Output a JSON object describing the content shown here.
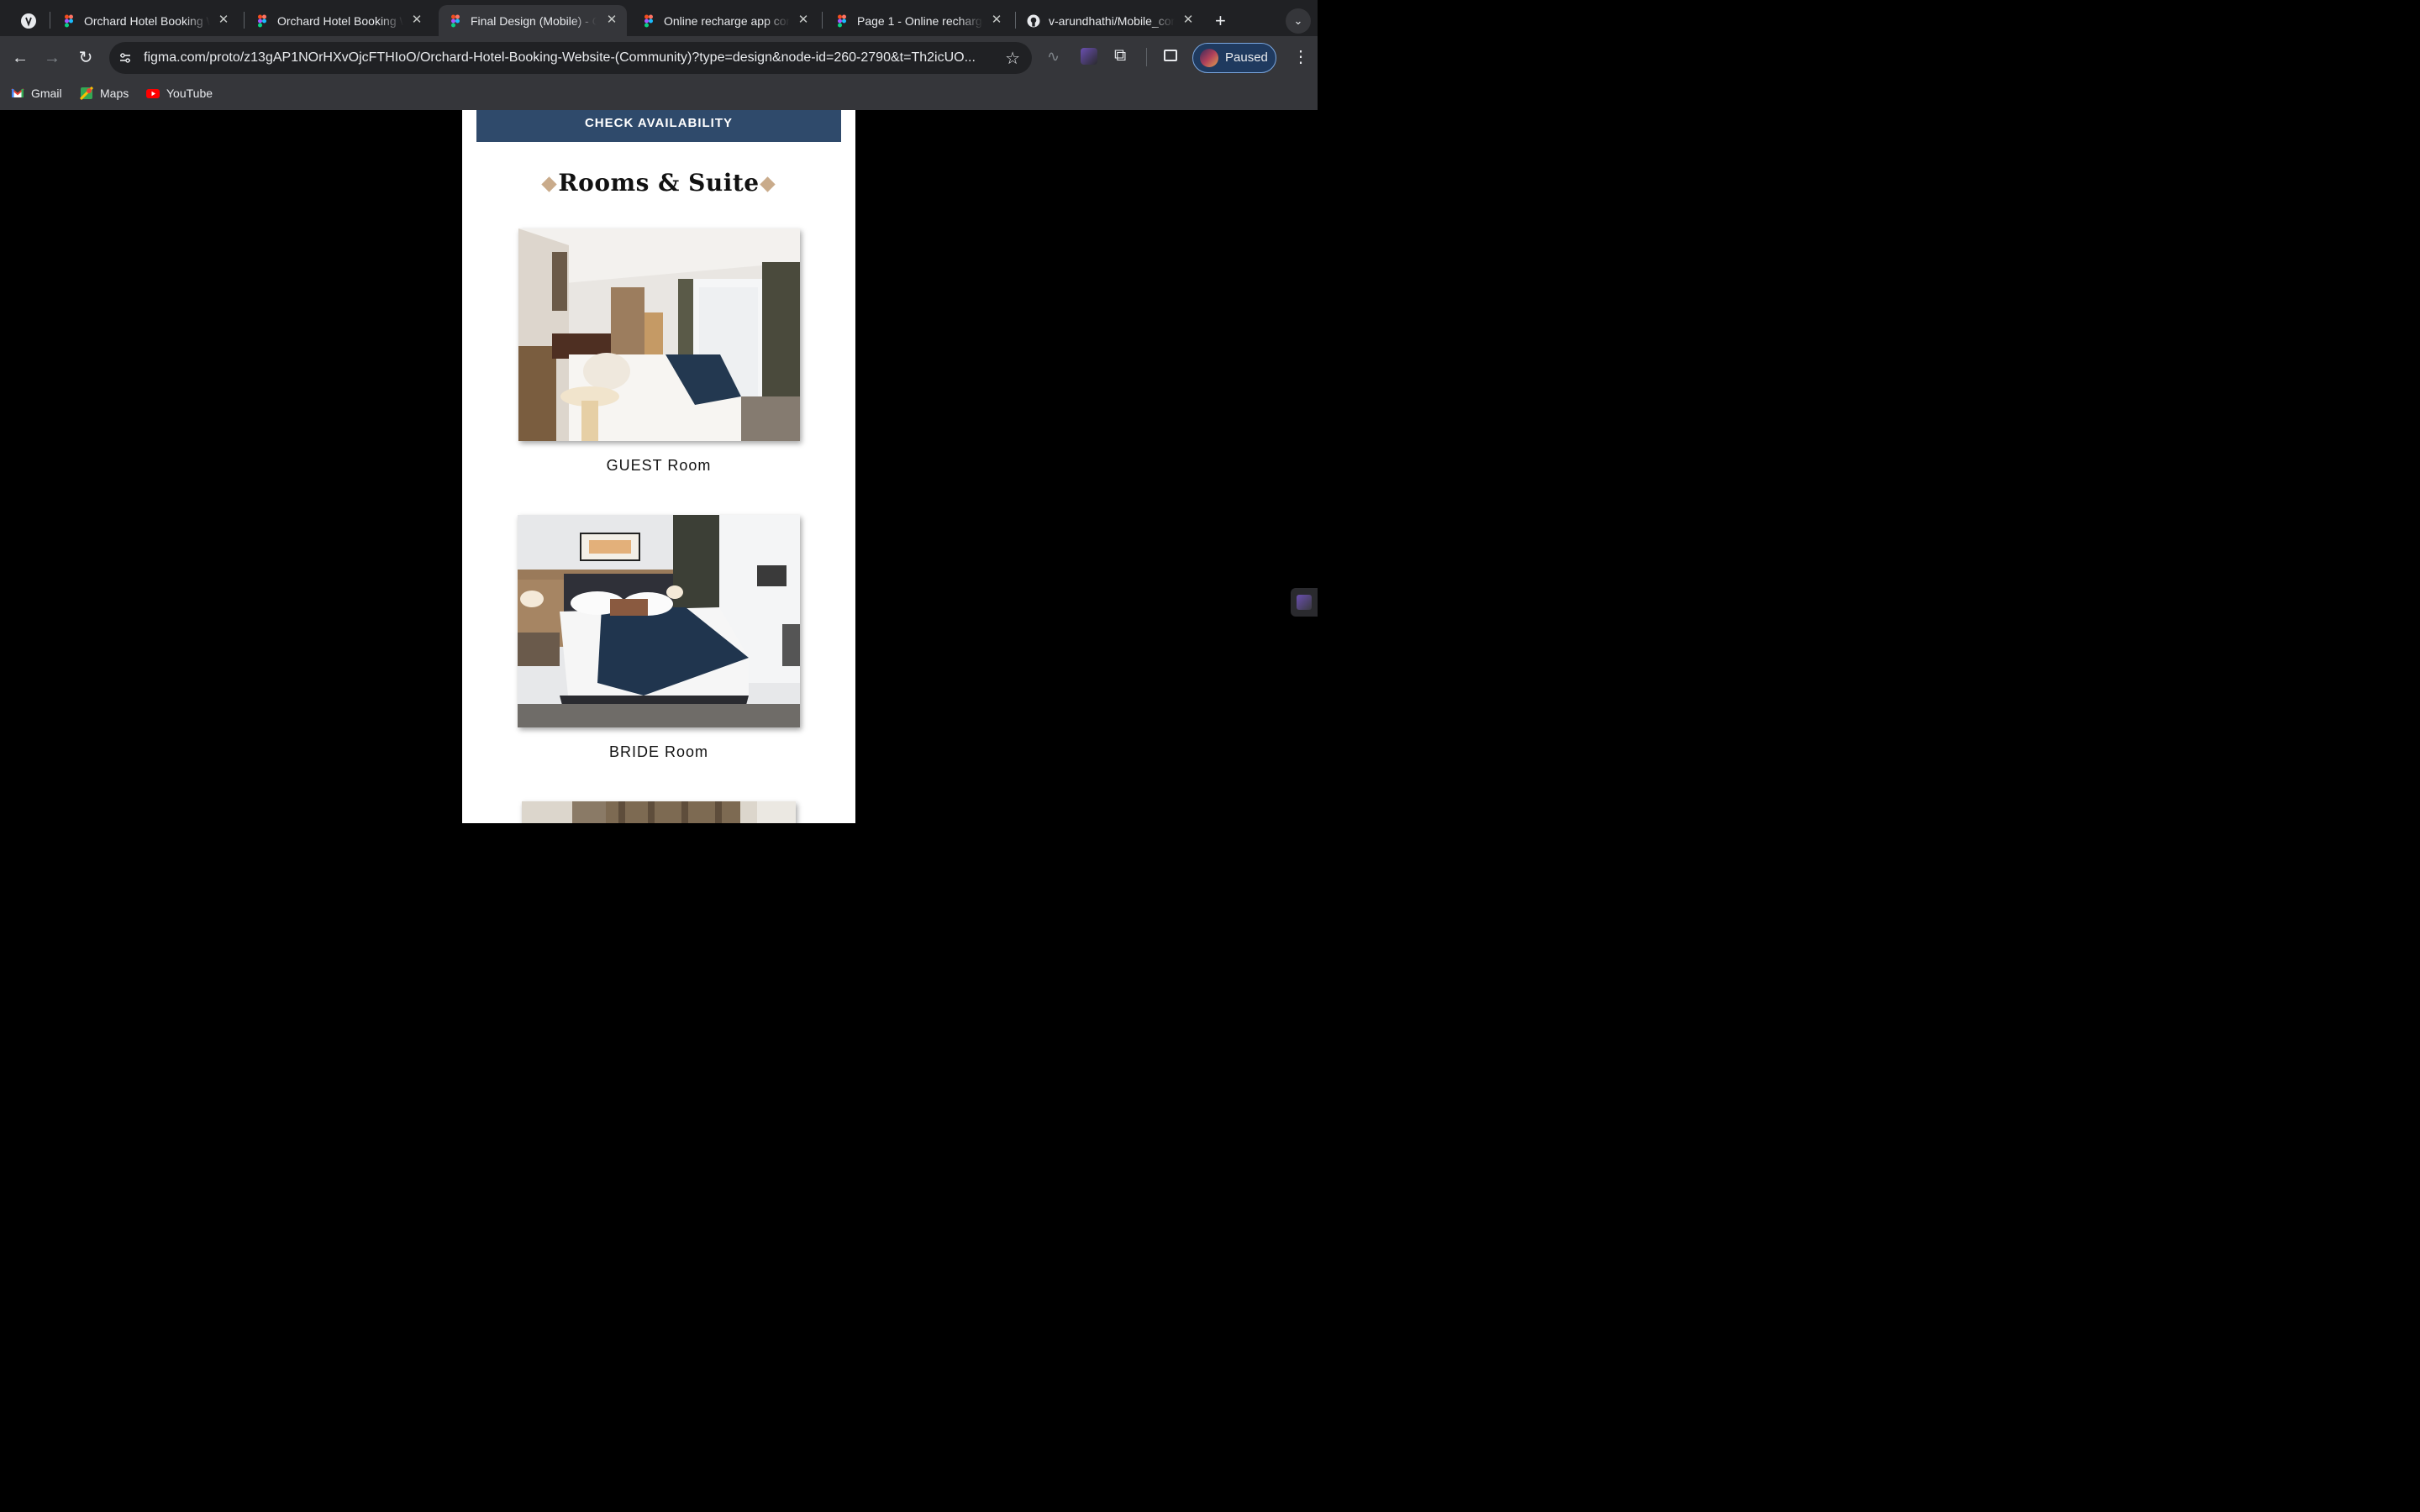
{
  "browser": {
    "tabs": [
      {
        "title": "Orchard Hotel Booking W",
        "icon": "figma-icon",
        "active": false
      },
      {
        "title": "Orchard Hotel Booking W",
        "icon": "figma-icon",
        "active": false
      },
      {
        "title": "Final Design (Mobile) - O",
        "icon": "figma-icon",
        "active": true
      },
      {
        "title": "Online recharge app con",
        "icon": "figma-icon",
        "active": false
      },
      {
        "title": "Page 1 - Online recharge",
        "icon": "figma-icon",
        "active": false
      },
      {
        "title": "v-arundhathi/Mobile_con",
        "icon": "github-icon",
        "active": false
      }
    ],
    "url": "figma.com/proto/z13gAP1NOrHXvOjcFTHIoO/Orchard-Hotel-Booking-Website-(Community)?type=design&node-id=260-2790&t=Th2icUO...",
    "profile_label": "Paused",
    "bookmarks": [
      {
        "label": "Gmail",
        "icon": "gmail-icon"
      },
      {
        "label": "Maps",
        "icon": "maps-icon"
      },
      {
        "label": "YouTube",
        "icon": "youtube-icon"
      }
    ]
  },
  "page": {
    "check_availability_label": "CHECK AVAILABILITY",
    "section_title": "Rooms & Suite",
    "rooms": [
      {
        "name": "GUEST Room"
      },
      {
        "name": "BRIDE Room"
      }
    ]
  },
  "colors": {
    "accent_blue": "#2f4a6b",
    "diamond": "#c9ab8b",
    "background": "#000000"
  }
}
